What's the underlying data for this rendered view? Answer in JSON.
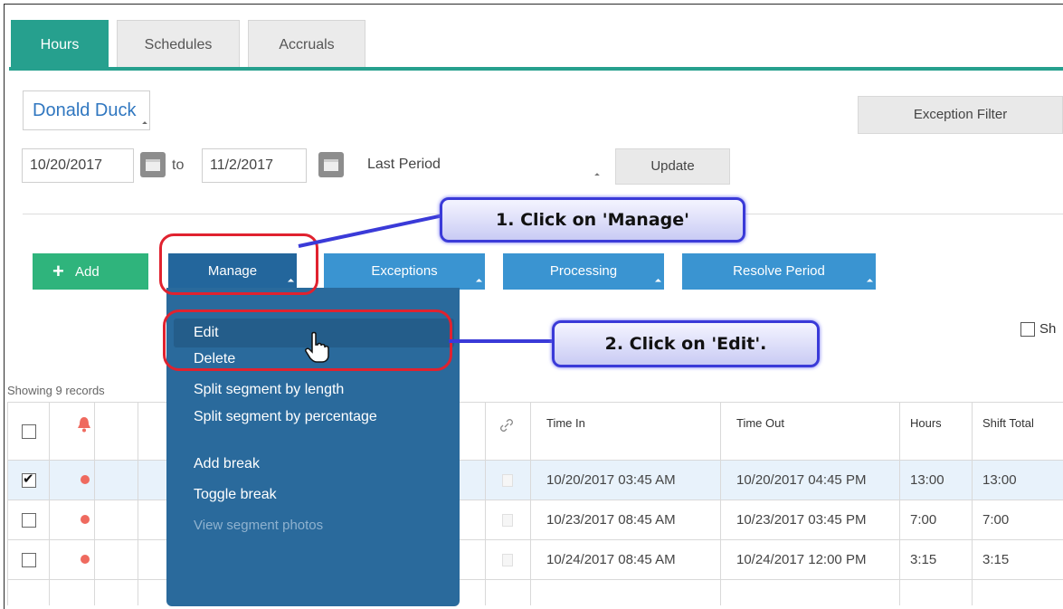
{
  "tabs": [
    {
      "label": "Hours"
    },
    {
      "label": "Schedules"
    },
    {
      "label": "Accruals"
    }
  ],
  "employee": {
    "name": "Donald Duck"
  },
  "exception_filter": {
    "label": "Exception Filter"
  },
  "date_range": {
    "from": "10/20/2017",
    "to_label": "to",
    "to": "11/2/2017",
    "period": "Last Period",
    "update_label": "Update"
  },
  "actions": {
    "add": "Add",
    "add_icon": "+",
    "manage": "Manage",
    "exceptions": "Exceptions",
    "processing": "Processing",
    "resolve": "Resolve Period"
  },
  "manage_menu": {
    "items": [
      "Edit",
      "Delete",
      "Split segment by length",
      "Split segment by percentage",
      "Add break",
      "Toggle break",
      "View segment photos"
    ]
  },
  "callouts": {
    "step1": "1. Click on 'Manage'",
    "step2": "2. Click on 'Edit'."
  },
  "show_toggle": {
    "label": "Sh"
  },
  "records": {
    "label": "Showing 9 records"
  },
  "table": {
    "headers": {
      "time_in": "Time In",
      "time_out": "Time Out",
      "hours": "Hours",
      "shift_total": "Shift Total"
    },
    "rows": [
      {
        "checked": true,
        "time_in": "10/20/2017 03:45 AM",
        "time_out": "10/20/2017 04:45 PM",
        "hours": "13:00",
        "shift_total": "13:00"
      },
      {
        "checked": false,
        "time_in": "10/23/2017 08:45 AM",
        "time_out": "10/23/2017 03:45 PM",
        "hours": "7:00",
        "shift_total": "7:00"
      },
      {
        "checked": false,
        "time_in": "10/24/2017 08:45 AM",
        "time_out": "10/24/2017 12:00 PM",
        "hours": "3:15",
        "shift_total": "3:15"
      }
    ]
  },
  "colors": {
    "accent_teal": "#26a08e",
    "action_blue": "#3a94d1",
    "add_green": "#2fb47c",
    "menu_navy": "#2a6a9c",
    "callout_border": "#3a3ad8",
    "highlight_red": "#e0222f"
  }
}
